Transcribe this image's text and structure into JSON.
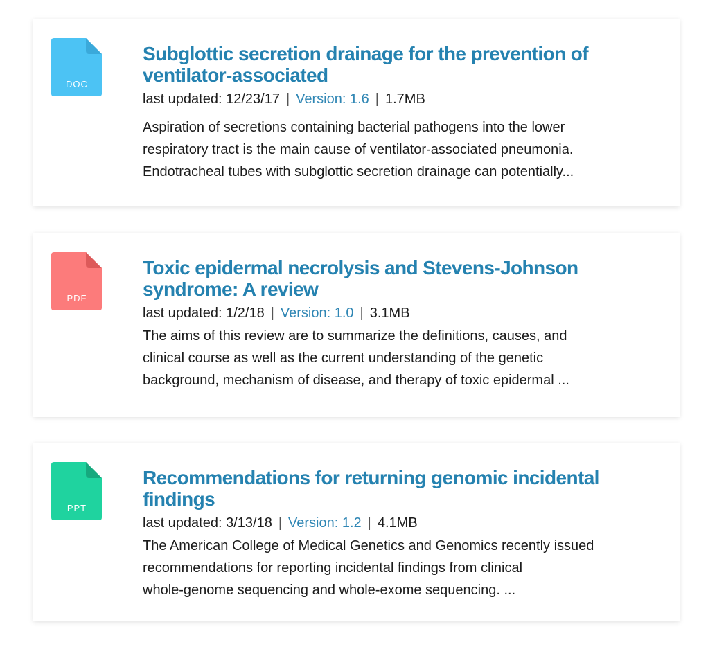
{
  "documents": [
    {
      "type": "DOC",
      "color": "#4cc3f4",
      "fold_color": "#3aa9da",
      "title": "Subglottic secretion drainage for the prevention of ventilator-associated",
      "updated_label": "last updated: 12/23/17",
      "version_label": "Version: 1.6",
      "size": "1.7MB",
      "desc_lines": [
        "Aspiration of secretions containing bacterial pathogens into the lower",
        "respiratory tract is the main cause of ventilator-associated pneumonia.",
        "Endotracheal tubes with subglottic secretion drainage can potentially..."
      ]
    },
    {
      "type": "PDF",
      "color": "#fc7b7b",
      "fold_color": "#dd5a5a",
      "title": "Toxic epidermal necrolysis and Stevens-Johnson syndrome: A review",
      "updated_label": "last updated: 1/2/18",
      "version_label": "Version: 1.0",
      "size": "3.1MB",
      "desc_lines": [
        "The aims of this review are to summarize the definitions, causes, and",
        "clinical course as well as the current understanding of the genetic",
        "background, mechanism of disease, and therapy of toxic epidermal ..."
      ]
    },
    {
      "type": "PPT",
      "color": "#1fd39f",
      "fold_color": "#16a97e",
      "title": "Recommendations for returning genomic incidental findings",
      "updated_label": "last updated: 3/13/18",
      "version_label": "Version: 1.2",
      "size": "4.1MB",
      "desc_lines": [
        "The American College of Medical Genetics and Genomics recently issued",
        "recommendations for reporting incidental findings from clinical",
        "whole-genome sequencing and whole-exome sequencing.  ..."
      ]
    }
  ],
  "separator": "|"
}
